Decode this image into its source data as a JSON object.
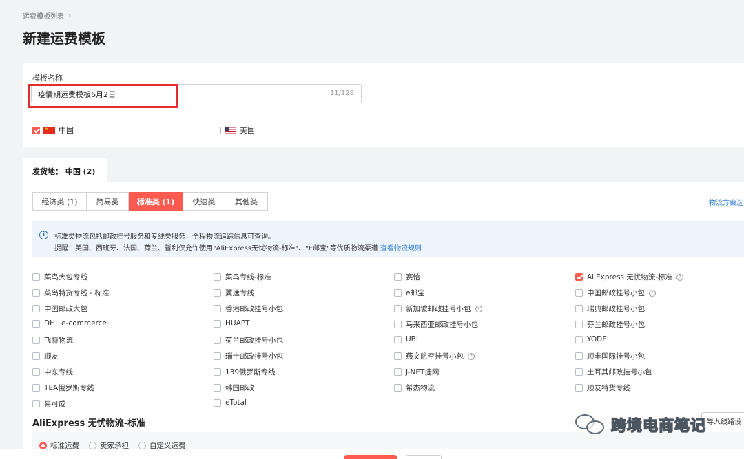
{
  "breadcrumb": {
    "parent": "运费模板列表"
  },
  "page_title": "新建运费模板",
  "template_name": {
    "label": "模板名称",
    "value": "疫情期运费模板6月2日",
    "counter": "11/128"
  },
  "countries": [
    {
      "name": "中国",
      "checked": true
    },
    {
      "name": "美国",
      "checked": false
    }
  ],
  "origin_tab": "发货地： 中国 (2)",
  "categories": [
    {
      "label": "经济类 (1)",
      "active": false
    },
    {
      "label": "简易类",
      "active": false
    },
    {
      "label": "标准类 (1)",
      "active": true
    },
    {
      "label": "快速类",
      "active": false
    },
    {
      "label": "其他类",
      "active": false
    }
  ],
  "right_link": "物流方案选",
  "info": {
    "line1": "标准类物流包括邮政挂号服务和专线类服务，全程物流追踪信息可查询。",
    "line2": "提醒：美国、西班牙、法国、荷兰、暂利仅允许使用\"AliExpress无忧物流-标准\"、\"E邮宝\"等优质物流渠道",
    "line2_link": "查看物流规则"
  },
  "options": [
    [
      "菜鸟大包专线",
      "菜鸟专线-标准",
      "赛恰",
      "AliExpress 无忧物流-标准"
    ],
    [
      "菜鸟特货专线 - 标准",
      "翼速专线",
      "e邮宝",
      "中国邮政挂号小包"
    ],
    [
      "中国邮政大包",
      "香港邮政挂号小包",
      "新加坡邮政挂号小包",
      "瑞典邮政挂号小包"
    ],
    [
      "DHL e-commerce",
      "HUAPT",
      "马来西亚邮政挂号小包",
      "芬兰邮政挂号小包"
    ],
    [
      "飞特物流",
      "荷兰邮政挂号小包",
      "UBI",
      "YODE"
    ],
    [
      "顺友",
      "瑞士邮政挂号小包",
      "燕文航空挂号小包",
      "顺丰国际挂号小包"
    ],
    [
      "中东专线",
      "139俄罗斯专线",
      "J-NET捷网",
      "土耳其邮政挂号小包"
    ],
    [
      "TEA俄罗斯专线",
      "韩国邮政",
      "希杰物流",
      "顺友特货专线"
    ],
    [
      "易可成",
      "eTotal",
      "",
      ""
    ]
  ],
  "section_title": "AliExpress 无忧物流-标准",
  "radios": [
    {
      "label": "标准运费",
      "selected": true
    },
    {
      "label": "卖家承担",
      "selected": false
    },
    {
      "label": "自定义运费",
      "selected": false
    }
  ],
  "route_button": "导入线路设",
  "watermark": "跨境电商笔记",
  "colors": {
    "accent": "#ff5a4f",
    "link": "#2b7cd3",
    "highlight_box": "#e52b2b"
  }
}
